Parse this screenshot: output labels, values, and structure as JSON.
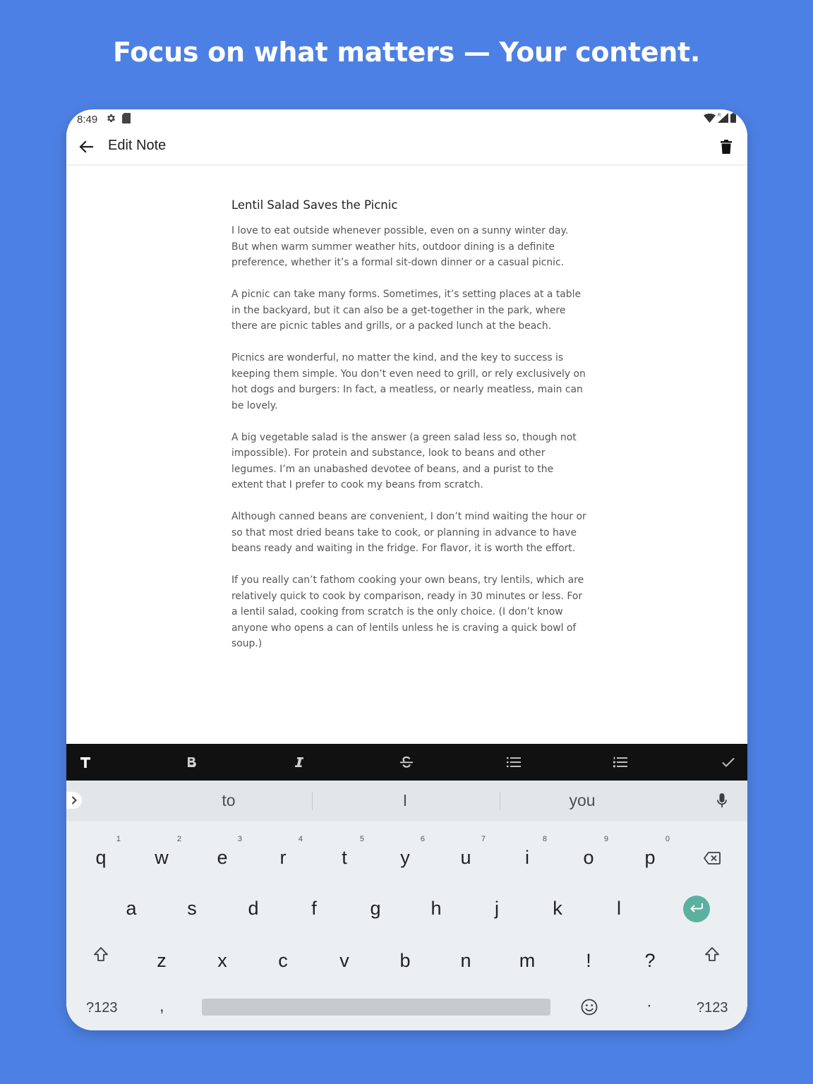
{
  "headline": "Focus on what matters — Your content.",
  "status": {
    "time": "8:49",
    "left_icons": [
      "gear-icon",
      "sd-card-icon"
    ],
    "right_icons": [
      "wifi-icon",
      "signal-icon",
      "battery-icon"
    ]
  },
  "appbar": {
    "title": "Edit Note",
    "back_icon": "arrow-back-icon",
    "delete_icon": "trash-icon"
  },
  "note": {
    "title": "Lentil Salad Saves the Picnic",
    "paragraphs": [
      "I love to eat outside whenever possible, even on a sunny winter day. But when warm summer weather hits, outdoor dining is a definite preference, whether it’s a formal sit-down dinner or a casual picnic.",
      "A picnic can take many forms. Sometimes, it’s setting places at a table in the backyard, but it can also be a get-together in the park, where there are picnic tables and grills, or a packed lunch at the beach.",
      "Picnics are wonderful, no matter the kind, and the key to success is keeping them simple. You don’t even need to grill, or rely exclusively on hot dogs and burgers: In fact, a meatless, or nearly meatless, main can be lovely.",
      "A big vegetable salad is the answer (a green salad less so, though not impossible). For protein and substance, look to beans and other legumes. I’m an unabashed devotee of beans, and a purist to the extent that I prefer to cook my beans from scratch.",
      "Although canned beans are convenient, I don’t mind waiting the hour or so that most dried beans take to cook, or planning in advance to have beans ready and waiting in the fridge. For flavor, it is worth the effort.",
      "If you really can’t fathom cooking your own beans, try lentils, which are relatively quick to cook by comparison, ready in 30 minutes or less. For a lentil salad, cooking from scratch is the only choice. (I don’t know anyone who opens a can of lentils unless he is craving a quick bowl of soup.)"
    ]
  },
  "format_toolbar": {
    "tools": [
      "text-style-icon",
      "bold-icon",
      "italic-icon",
      "strikethrough-icon",
      "bullet-list-icon",
      "numbered-list-icon",
      "check-icon"
    ]
  },
  "keyboard": {
    "suggestions": [
      "to",
      "I",
      "you"
    ],
    "row1": [
      {
        "ch": "q",
        "num": "1"
      },
      {
        "ch": "w",
        "num": "2"
      },
      {
        "ch": "e",
        "num": "3"
      },
      {
        "ch": "r",
        "num": "4"
      },
      {
        "ch": "t",
        "num": "5"
      },
      {
        "ch": "y",
        "num": "6"
      },
      {
        "ch": "u",
        "num": "7"
      },
      {
        "ch": "i",
        "num": "8"
      },
      {
        "ch": "o",
        "num": "9"
      },
      {
        "ch": "p",
        "num": "0"
      }
    ],
    "row2": [
      "a",
      "s",
      "d",
      "f",
      "g",
      "h",
      "j",
      "k",
      "l"
    ],
    "row3": [
      "z",
      "x",
      "c",
      "v",
      "b",
      "n",
      "m",
      "!",
      "?"
    ],
    "symbols_label": "?123",
    "comma": ",",
    "period": "·",
    "accent_color": "#5bb19f"
  }
}
